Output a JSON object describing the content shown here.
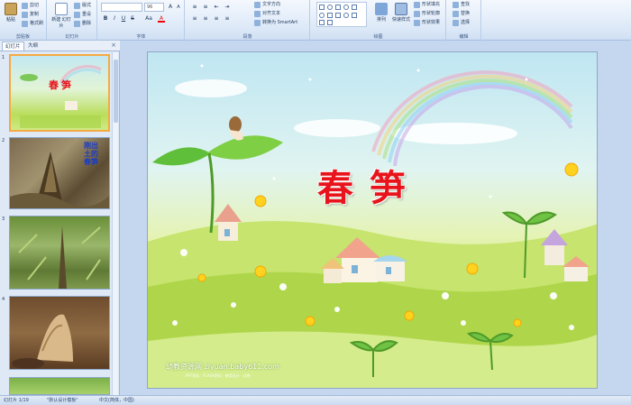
{
  "ribbon": {
    "clipboard": {
      "label": "剪贴板",
      "paste": "粘贴",
      "cut": "剪切",
      "copy": "复制",
      "format_painter": "格式刷"
    },
    "slides": {
      "label": "幻灯片",
      "new_slide": "新建\n幻灯片",
      "layout": "版式",
      "reset": "重设",
      "delete": "删除"
    },
    "font": {
      "label": "字体",
      "font_size": "96",
      "bold": "B",
      "italic": "I",
      "underline": "U",
      "strike": "S",
      "aa": "Aa",
      "color": "A"
    },
    "paragraph": {
      "label": "段落",
      "text_direction": "文字方向",
      "align_text": "对齐文本",
      "smartart": "转换为 SmartArt"
    },
    "drawing": {
      "label": "绘图",
      "arrange": "排列",
      "quick_styles": "快速样式",
      "shape_fill": "形状填充",
      "shape_outline": "形状轮廓",
      "shape_effects": "形状效果"
    },
    "editing": {
      "label": "编辑",
      "find": "查找",
      "replace": "替换",
      "select": "选择"
    }
  },
  "panel": {
    "tab_slides": "幻灯片",
    "tab_outline": "大纲",
    "close": "×",
    "thumbnails": [
      {
        "num": "1",
        "title": "春笋"
      },
      {
        "num": "2",
        "title": "刚出土的春笋"
      },
      {
        "num": "3",
        "title": ""
      },
      {
        "num": "4",
        "title": ""
      }
    ]
  },
  "slide": {
    "title": "春笋",
    "watermark": "幼教资源网 ziyuan.baby611.com",
    "watermark_sub": "PPT资料 · FLASH资料 · 教案设计 · 试卷"
  },
  "status": {
    "slide_info": "幻灯片 1/19",
    "theme": "\"默认设计模板\"",
    "language": "中文(简体，中国)"
  },
  "colors": {
    "title": "#e8141c",
    "ribbon_bg": "#dde9f8",
    "workspace": "#c5d7ee",
    "selection": "#f6a941"
  }
}
